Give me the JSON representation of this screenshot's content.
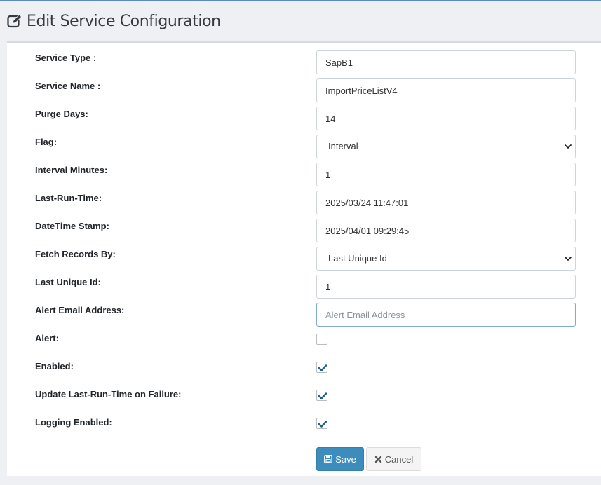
{
  "page": {
    "title": "Edit Service Configuration"
  },
  "form": {
    "service_type": {
      "label": "Service Type :",
      "value": "SapB1"
    },
    "service_name": {
      "label": "Service Name :",
      "value": "ImportPriceListV4"
    },
    "purge_days": {
      "label": "Purge Days:",
      "value": "14"
    },
    "flag": {
      "label": "Flag:",
      "selected": "Interval"
    },
    "interval_minutes": {
      "label": "Interval Minutes:",
      "value": "1"
    },
    "last_run_time": {
      "label": "Last-Run-Time:",
      "value": "2025/03/24 11:47:01"
    },
    "datetime_stamp": {
      "label": "DateTime Stamp:",
      "value": "2025/04/01 09:29:45"
    },
    "fetch_records_by": {
      "label": "Fetch Records By:",
      "selected": "Last Unique Id"
    },
    "last_unique_id": {
      "label": "Last Unique Id:",
      "value": "1"
    },
    "alert_email": {
      "label": "Alert Email Address:",
      "value": "",
      "placeholder": "Alert Email Address"
    },
    "alert": {
      "label": "Alert:",
      "checked": false
    },
    "enabled": {
      "label": "Enabled:",
      "checked": true
    },
    "update_on_failure": {
      "label": "Update Last-Run-Time on Failure:",
      "checked": true
    },
    "logging_enabled": {
      "label": "Logging Enabled:",
      "checked": true
    }
  },
  "buttons": {
    "save": "Save",
    "cancel": "Cancel"
  },
  "icons": {
    "title": "edit-icon",
    "save": "floppy-disk-icon",
    "cancel": "times-icon",
    "select": "chevron-down-icon",
    "check": "check-icon"
  },
  "colors": {
    "primary": "#3c8dbc",
    "check": "#1d5d8a"
  }
}
